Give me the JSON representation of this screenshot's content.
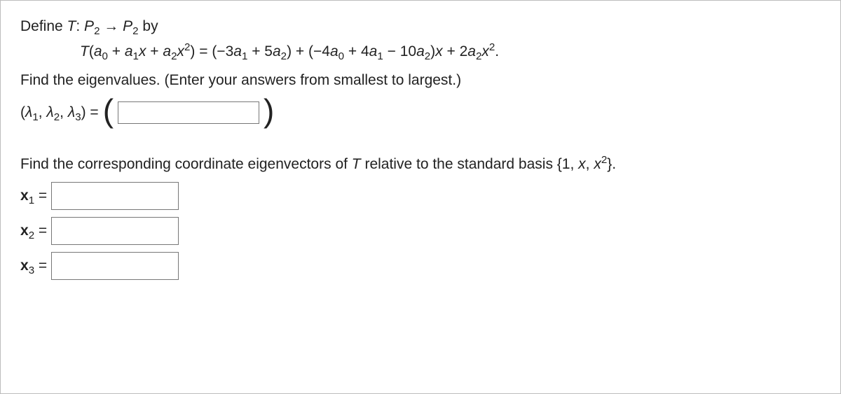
{
  "title": "Define T: P₂ → P₂ by",
  "equation": "T(a₀ + a₁x + a₂x²) = (−3a₁ + 5a₂) + (−4a₀ + 4a₁ − 10a₂)x + 2a₂x².",
  "prompt_eigenvalues": "Find the eigenvalues. (Enter your answers from smallest to largest.)",
  "lambda_label": "(λ₁, λ₂, λ₃) = ",
  "lambda_input": "",
  "prompt_eigenvectors": "Find the corresponding coordinate eigenvectors of T relative to the standard basis {1, x, x²}.",
  "x_rows": [
    {
      "label_html": "x1",
      "value": ""
    },
    {
      "label_html": "x2",
      "value": ""
    },
    {
      "label_html": "x3",
      "value": ""
    }
  ],
  "mathjson": {
    "domain": "P2",
    "codomain": "P2",
    "input_basis": [
      "1",
      "x",
      "x^2"
    ],
    "output_coeffs": {
      "const": {
        "a0": 0,
        "a1": -3,
        "a2": 5
      },
      "x": {
        "a0": -4,
        "a1": 4,
        "a2": -10
      },
      "x2": {
        "a0": 0,
        "a1": 0,
        "a2": 2
      }
    }
  }
}
